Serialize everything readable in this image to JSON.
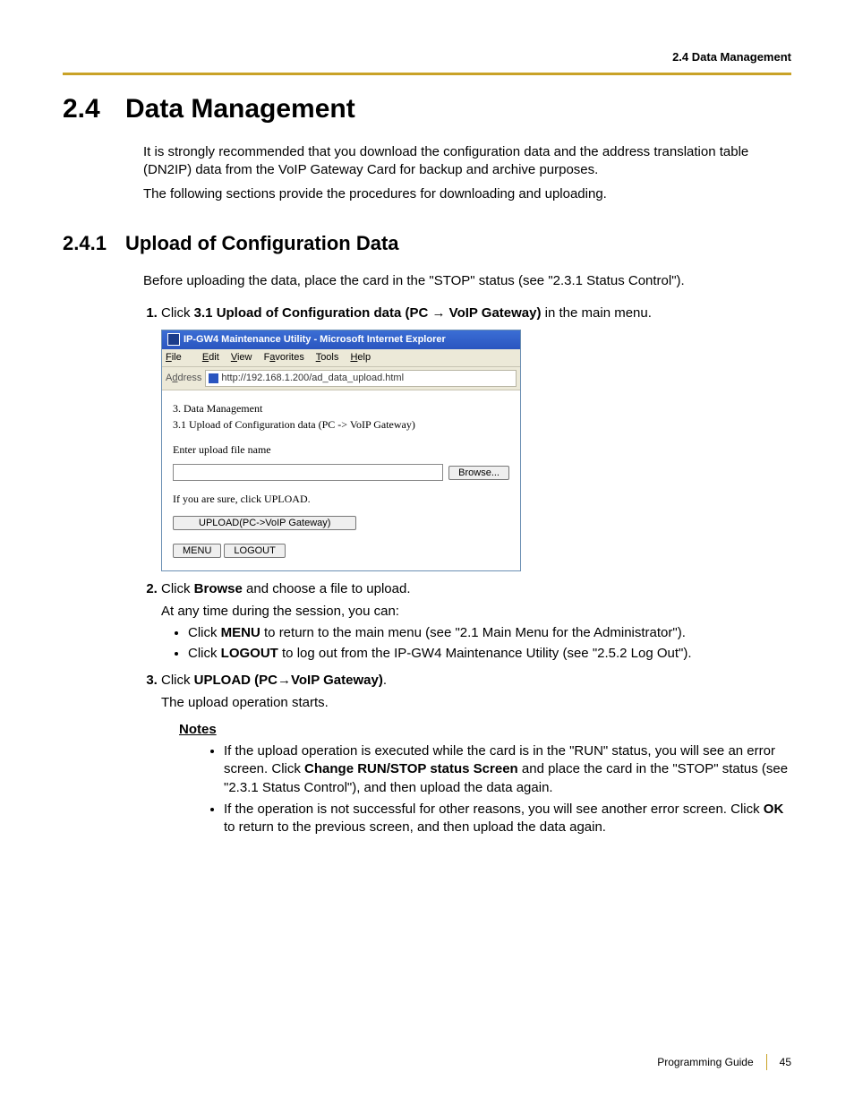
{
  "header": {
    "running": "2.4 Data Management"
  },
  "section": {
    "num": "2.4",
    "title": "Data Management",
    "intro1": "It is strongly recommended that you download the configuration data and the address translation table (DN2IP) data from the VoIP Gateway Card for backup and archive purposes.",
    "intro2": "The following sections provide the procedures for downloading and uploading."
  },
  "subsection": {
    "num": "2.4.1",
    "title": "Upload of Configuration Data",
    "intro": "Before uploading the data, place the card in the \"STOP\" status (see \"2.3.1 Status Control\")."
  },
  "steps": {
    "s1": {
      "pre": "Click ",
      "bold": "3.1 Upload of Configuration data (PC → VoIP Gateway)",
      "post": " in the main menu."
    },
    "s2": {
      "pre": "Click ",
      "bold": "Browse",
      "post": " and choose a file to upload.",
      "line2": "At any time during the session, you can:",
      "b1_pre": "Click ",
      "b1_bold": "MENU",
      "b1_post": " to return to the main menu (see \"2.1 Main Menu for the Administrator\").",
      "b2_pre": "Click ",
      "b2_bold": "LOGOUT",
      "b2_post": " to log out from the IP-GW4 Maintenance Utility (see \"2.5.2 Log Out\")."
    },
    "s3": {
      "pre": "Click ",
      "bold": "UPLOAD (PC→VoIP Gateway)",
      "post": ".",
      "line2": "The upload operation starts."
    }
  },
  "notes": {
    "label": "Notes",
    "n1_a": "If the upload operation is executed while the card is in the \"RUN\" status, you will see an error screen. Click ",
    "n1_b": "Change RUN/STOP status Screen",
    "n1_c": " and place the card in the \"STOP\" status (see \"2.3.1 Status Control\"), and then upload the data again.",
    "n2_a": "If the operation is not successful for other reasons, you will see another error screen. Click ",
    "n2_b": "OK",
    "n2_c": " to return to the previous screen, and then upload the data again."
  },
  "ie": {
    "title": "IP-GW4 Maintenance Utility - Microsoft Internet Explorer",
    "menu": {
      "file": "File",
      "edit": "Edit",
      "view": "View",
      "fav": "Favorites",
      "tools": "Tools",
      "help": "Help"
    },
    "address_label": "Address",
    "url": "http://192.168.1.200/ad_data_upload.html",
    "line1": "3. Data Management",
    "line2": "3.1 Upload of Configuration data (PC -> VoIP Gateway)",
    "label_enter": "Enter upload file name",
    "browse": "Browse...",
    "confirm": "If you are sure, click UPLOAD.",
    "upload_btn": "UPLOAD(PC->VoIP Gateway)",
    "menu_btn": "MENU",
    "logout_btn": "LOGOUT"
  },
  "footer": {
    "guide": "Programming Guide",
    "page": "45"
  }
}
